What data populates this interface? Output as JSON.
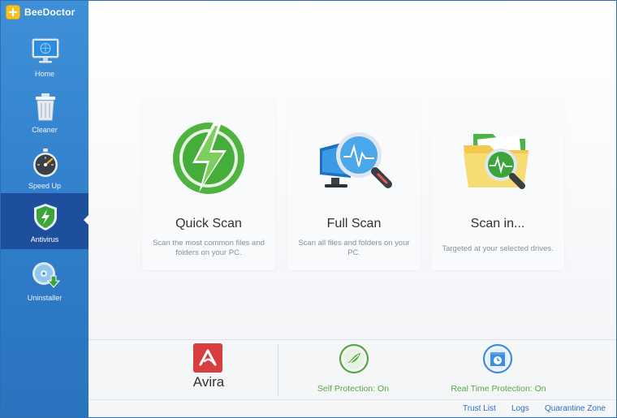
{
  "app": {
    "name": "BeeDoctor"
  },
  "sidebar": {
    "items": [
      {
        "label": "Home"
      },
      {
        "label": "Cleaner"
      },
      {
        "label": "Speed Up"
      },
      {
        "label": "Antivirus",
        "active": true
      },
      {
        "label": "Uninstaller"
      }
    ]
  },
  "scan_cards": [
    {
      "title": "Quick Scan",
      "desc": "Scan the most common files and folders on your PC."
    },
    {
      "title": "Full Scan",
      "desc": "Scan all files and folders on your PC."
    },
    {
      "title": "Scan in...",
      "desc": "Targeted at your selected drives."
    }
  ],
  "status": {
    "engine": "Avira",
    "self_protection": "Self Protection: On",
    "realtime_protection": "Real Time Protection: On"
  },
  "footer": {
    "links": [
      "Trust List",
      "Logs",
      "Quarantine Zone"
    ]
  },
  "colors": {
    "sidebar": "#3f8fd8",
    "sidebar_active": "#1e4f9c",
    "status_on": "#5aa541",
    "link": "#2e6fc0",
    "avira": "#d83e3e"
  }
}
